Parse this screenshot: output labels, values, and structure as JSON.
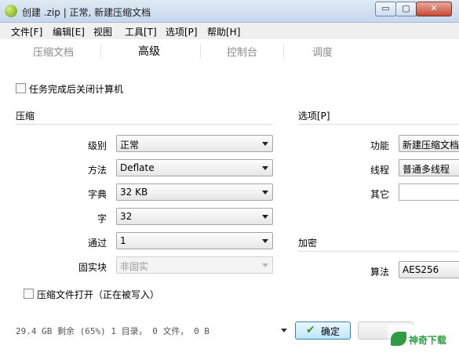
{
  "window": {
    "title": "创建 .zip | 正常, 新建压缩文档",
    "min_glyph": "▭",
    "max_glyph": "▢",
    "close_glyph": "✕"
  },
  "menu": [
    "文件[F]",
    "编辑[E]",
    "视图",
    "工具[T]",
    "选项[P]",
    "帮助[H]"
  ],
  "tabs": [
    "压缩文档",
    "高级",
    "控制台",
    "调度"
  ],
  "shutdown_checkbox": {
    "label": "任务完成后关闭计算机",
    "checked": false
  },
  "compression": {
    "title": "压缩",
    "level": {
      "label": "级别",
      "value": "正常"
    },
    "method": {
      "label": "方法",
      "value": "Deflate"
    },
    "dictionary": {
      "label": "字典",
      "value": "32 KB"
    },
    "word": {
      "label": "字",
      "value": "32"
    },
    "passes": {
      "label": "通过",
      "value": "1"
    },
    "solid_block": {
      "label": "固实块",
      "value": "非固实",
      "disabled": true
    }
  },
  "options": {
    "title": "选项[P]",
    "function": {
      "label": "功能",
      "value": "新建压缩文档"
    },
    "threads": {
      "label": "线程",
      "value": "普通多线程"
    },
    "other": {
      "label": "其它",
      "value": ""
    }
  },
  "encryption": {
    "title": "加密",
    "algorithm": {
      "label": "算法",
      "value": "AES256"
    }
  },
  "compress_open_checkbox": {
    "label": "压缩文件打开（正在被写入）",
    "checked": false
  },
  "status": "29.4 GB 剩余 (65%)  1 目录， 0 文件， 0 B",
  "buttons": {
    "ok": "确定",
    "ok_icon": "✔"
  },
  "watermark": {
    "text": "神奇下载",
    "icon": "leaf-logo"
  },
  "colors": {
    "accent": "#3c7fb1",
    "ok_check": "#2c9a22",
    "watermark": "#2f9b45"
  }
}
